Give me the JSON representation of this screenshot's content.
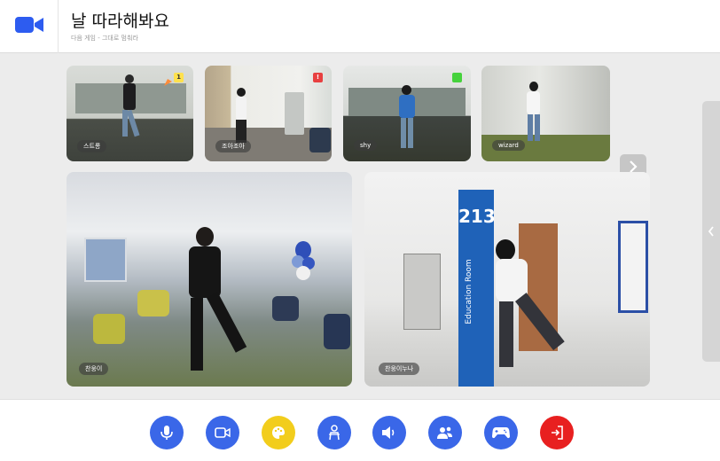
{
  "header": {
    "title": "날 따라해봐요",
    "subtitle": "다음 게임 - 그대로 멈춰라",
    "logo_icon": "video-camera-icon",
    "logo_color": "#2d5cf0"
  },
  "participants_top": [
    {
      "name": "스트롱",
      "badge": "1",
      "badge_color": "#ffe14d",
      "badge_icon": "crown-flag-icon"
    },
    {
      "name": "조아조아",
      "badge": "",
      "badge_color": "#e84040",
      "badge_icon": "alert-badge-icon"
    },
    {
      "name": "shy",
      "badge": "",
      "badge_color": "#45d23c",
      "badge_icon": "check-badge-icon"
    },
    {
      "name": "wizard",
      "badge": "",
      "badge_color": "",
      "badge_icon": ""
    }
  ],
  "participants_main": [
    {
      "name": "찬웅이"
    },
    {
      "name": "찬웅이누나"
    }
  ],
  "stage_extra": {
    "room_sign": "213",
    "wall_text": "Education Room"
  },
  "navigation": {
    "next_icon": "chevron-right-icon",
    "side_panel_icon": "chevron-left-icon"
  },
  "controls": [
    {
      "name": "mic-button",
      "icon": "microphone-icon",
      "color": "#3a67e8"
    },
    {
      "name": "camera-button",
      "icon": "camera-icon",
      "color": "#3a67e8"
    },
    {
      "name": "palette-button",
      "icon": "palette-icon",
      "color": "#f2cd1c"
    },
    {
      "name": "avatar-button",
      "icon": "person-effect-icon",
      "color": "#3a67e8"
    },
    {
      "name": "speaker-button",
      "icon": "speaker-icon",
      "color": "#3a67e8"
    },
    {
      "name": "participants-button",
      "icon": "users-icon",
      "color": "#3a67e8"
    },
    {
      "name": "game-button",
      "icon": "gamepad-icon",
      "color": "#3a67e8"
    },
    {
      "name": "exit-button",
      "icon": "exit-icon",
      "color": "#e82020"
    }
  ]
}
